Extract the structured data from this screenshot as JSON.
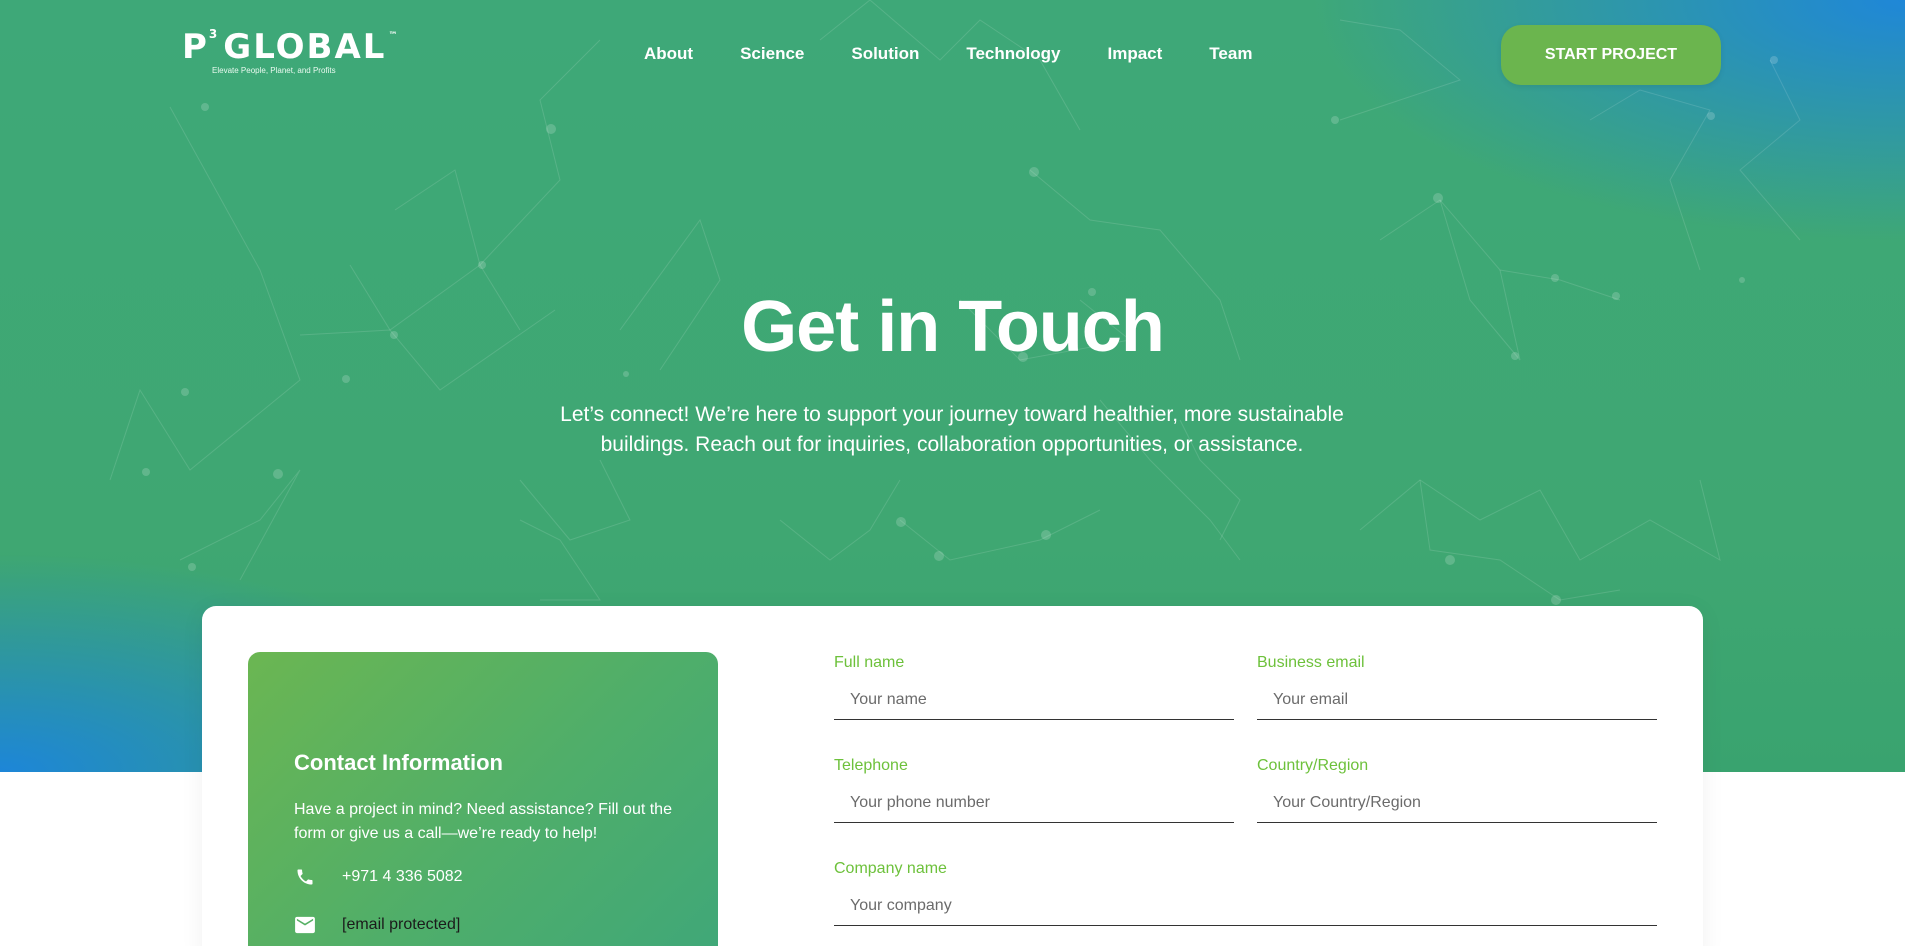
{
  "brand": {
    "logo_p": "P",
    "logo_sup": "3",
    "logo_text": "GLOBAL",
    "logo_tm": "™",
    "tagline": "Elevate People, Planet, and Profits"
  },
  "nav": {
    "items": [
      {
        "label": "About"
      },
      {
        "label": "Science"
      },
      {
        "label": "Solution"
      },
      {
        "label": "Technology"
      },
      {
        "label": "Impact"
      },
      {
        "label": "Team"
      }
    ],
    "cta_label": "START PROJECT"
  },
  "hero": {
    "title": "Get in Touch",
    "subtitle": "Let’s connect! We’re here to support your journey toward healthier, more sustainable buildings. Reach out for inquiries, collaboration opportunities, or assistance."
  },
  "contact": {
    "title": "Contact Information",
    "description": "Have a project in mind? Need assistance? Fill out the form or give us a call—we’re ready to help!",
    "phone": "+971 4 336 5082",
    "email": "[email protected]",
    "phone_icon": "phone-icon",
    "email_icon": "mail-icon"
  },
  "form": {
    "full_name": {
      "label": "Full name",
      "placeholder": "Your name",
      "value": ""
    },
    "business_email": {
      "label": "Business email",
      "placeholder": "Your email",
      "value": ""
    },
    "telephone": {
      "label": "Telephone",
      "placeholder": "Your phone number",
      "value": ""
    },
    "country": {
      "label": "Country/Region",
      "placeholder": "Your Country/Region",
      "value": ""
    },
    "company": {
      "label": "Company name",
      "placeholder": "Your company",
      "value": ""
    }
  },
  "colors": {
    "hero_green": "#3fa772",
    "accent_blue": "#1f87d8",
    "cta_green": "#6bb54e",
    "label_green": "#6dc13b"
  }
}
